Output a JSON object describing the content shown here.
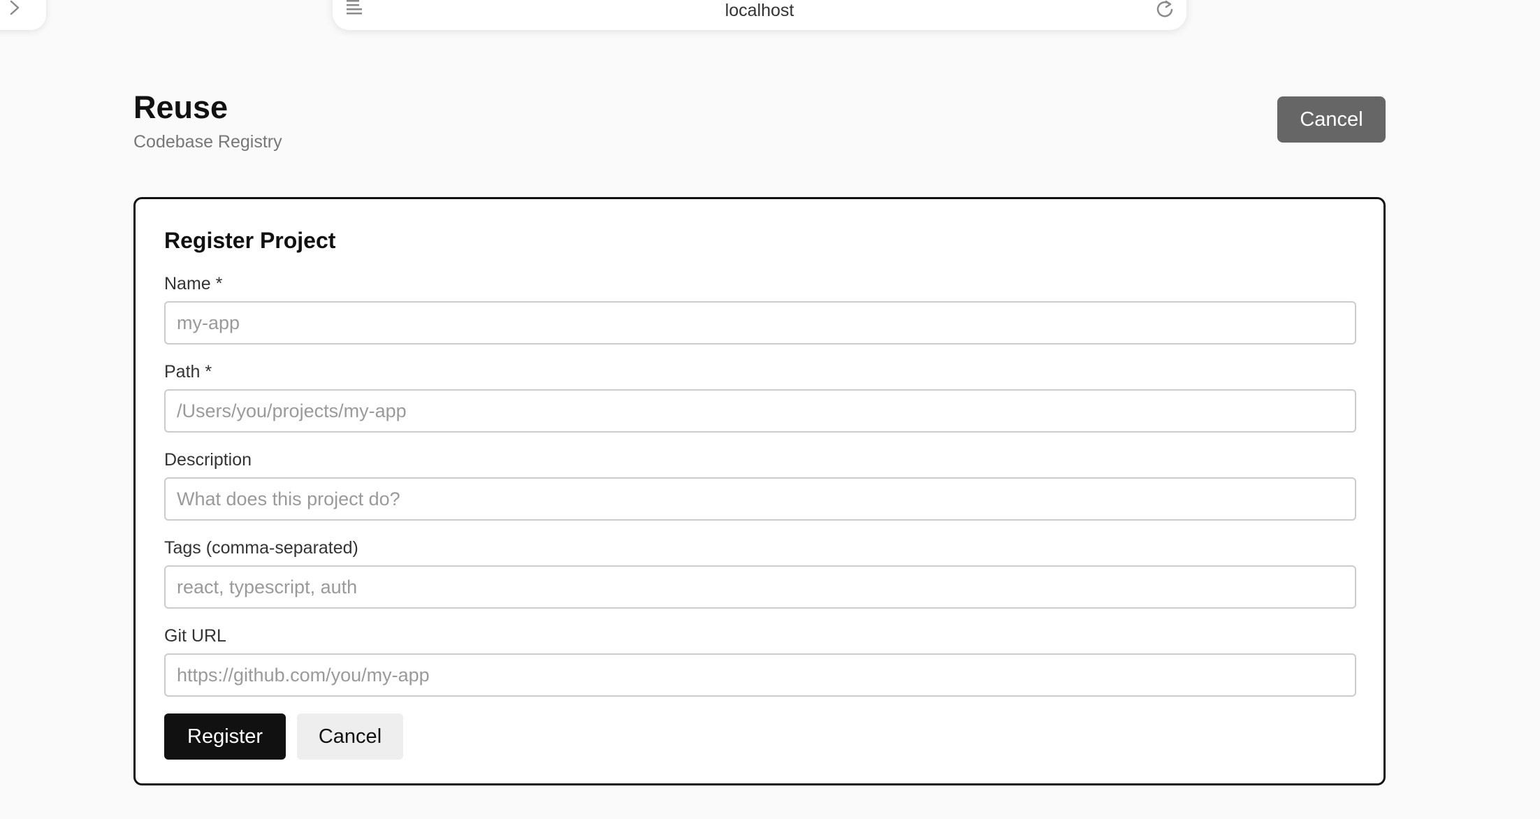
{
  "browser": {
    "url": "localhost",
    "icons": {
      "back": "chevron-right-icon",
      "reader": "reader-mode-icon",
      "reload": "reload-icon"
    }
  },
  "header": {
    "title": "Reuse",
    "subtitle": "Codebase Registry",
    "cancel_label": "Cancel"
  },
  "form": {
    "title": "Register Project",
    "fields": [
      {
        "label": "Name *",
        "value": "",
        "placeholder": "my-app"
      },
      {
        "label": "Path *",
        "value": "",
        "placeholder": "/Users/you/projects/my-app"
      },
      {
        "label": "Description",
        "value": "",
        "placeholder": "What does this project do?"
      },
      {
        "label": "Tags (comma-separated)",
        "value": "",
        "placeholder": "react, typescript, auth"
      },
      {
        "label": "Git URL",
        "value": "",
        "placeholder": "https://github.com/you/my-app"
      }
    ],
    "register_label": "Register",
    "cancel_label": "Cancel"
  },
  "colors": {
    "background": "#fafafa",
    "primary_button": "#111111",
    "header_cancel_button": "#666666",
    "secondary_button": "#eeeeee",
    "card_border": "#111111",
    "input_border": "#cccccc"
  }
}
